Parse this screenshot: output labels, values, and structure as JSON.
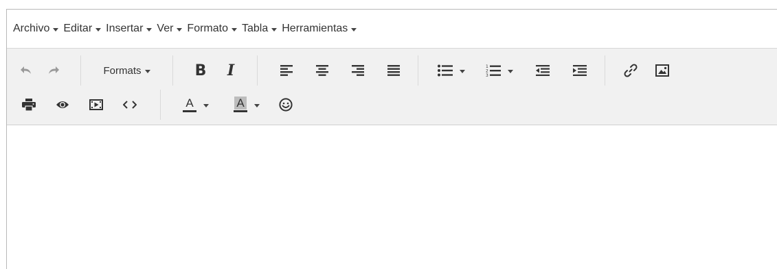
{
  "menubar": {
    "items": [
      {
        "label": "Archivo"
      },
      {
        "label": "Editar"
      },
      {
        "label": "Insertar"
      },
      {
        "label": "Ver"
      },
      {
        "label": "Formato"
      },
      {
        "label": "Tabla"
      },
      {
        "label": "Herramientas"
      }
    ]
  },
  "toolbar": {
    "formats_label": "Formats",
    "bold_label": "B",
    "italic_label": "I",
    "text_color_label": "A",
    "bg_color_label": "A"
  },
  "colors": {
    "toolbar_bg": "#f1f1f1",
    "border": "#b8b8b8",
    "icon": "#333333",
    "icon_disabled": "#9a9a9a"
  }
}
